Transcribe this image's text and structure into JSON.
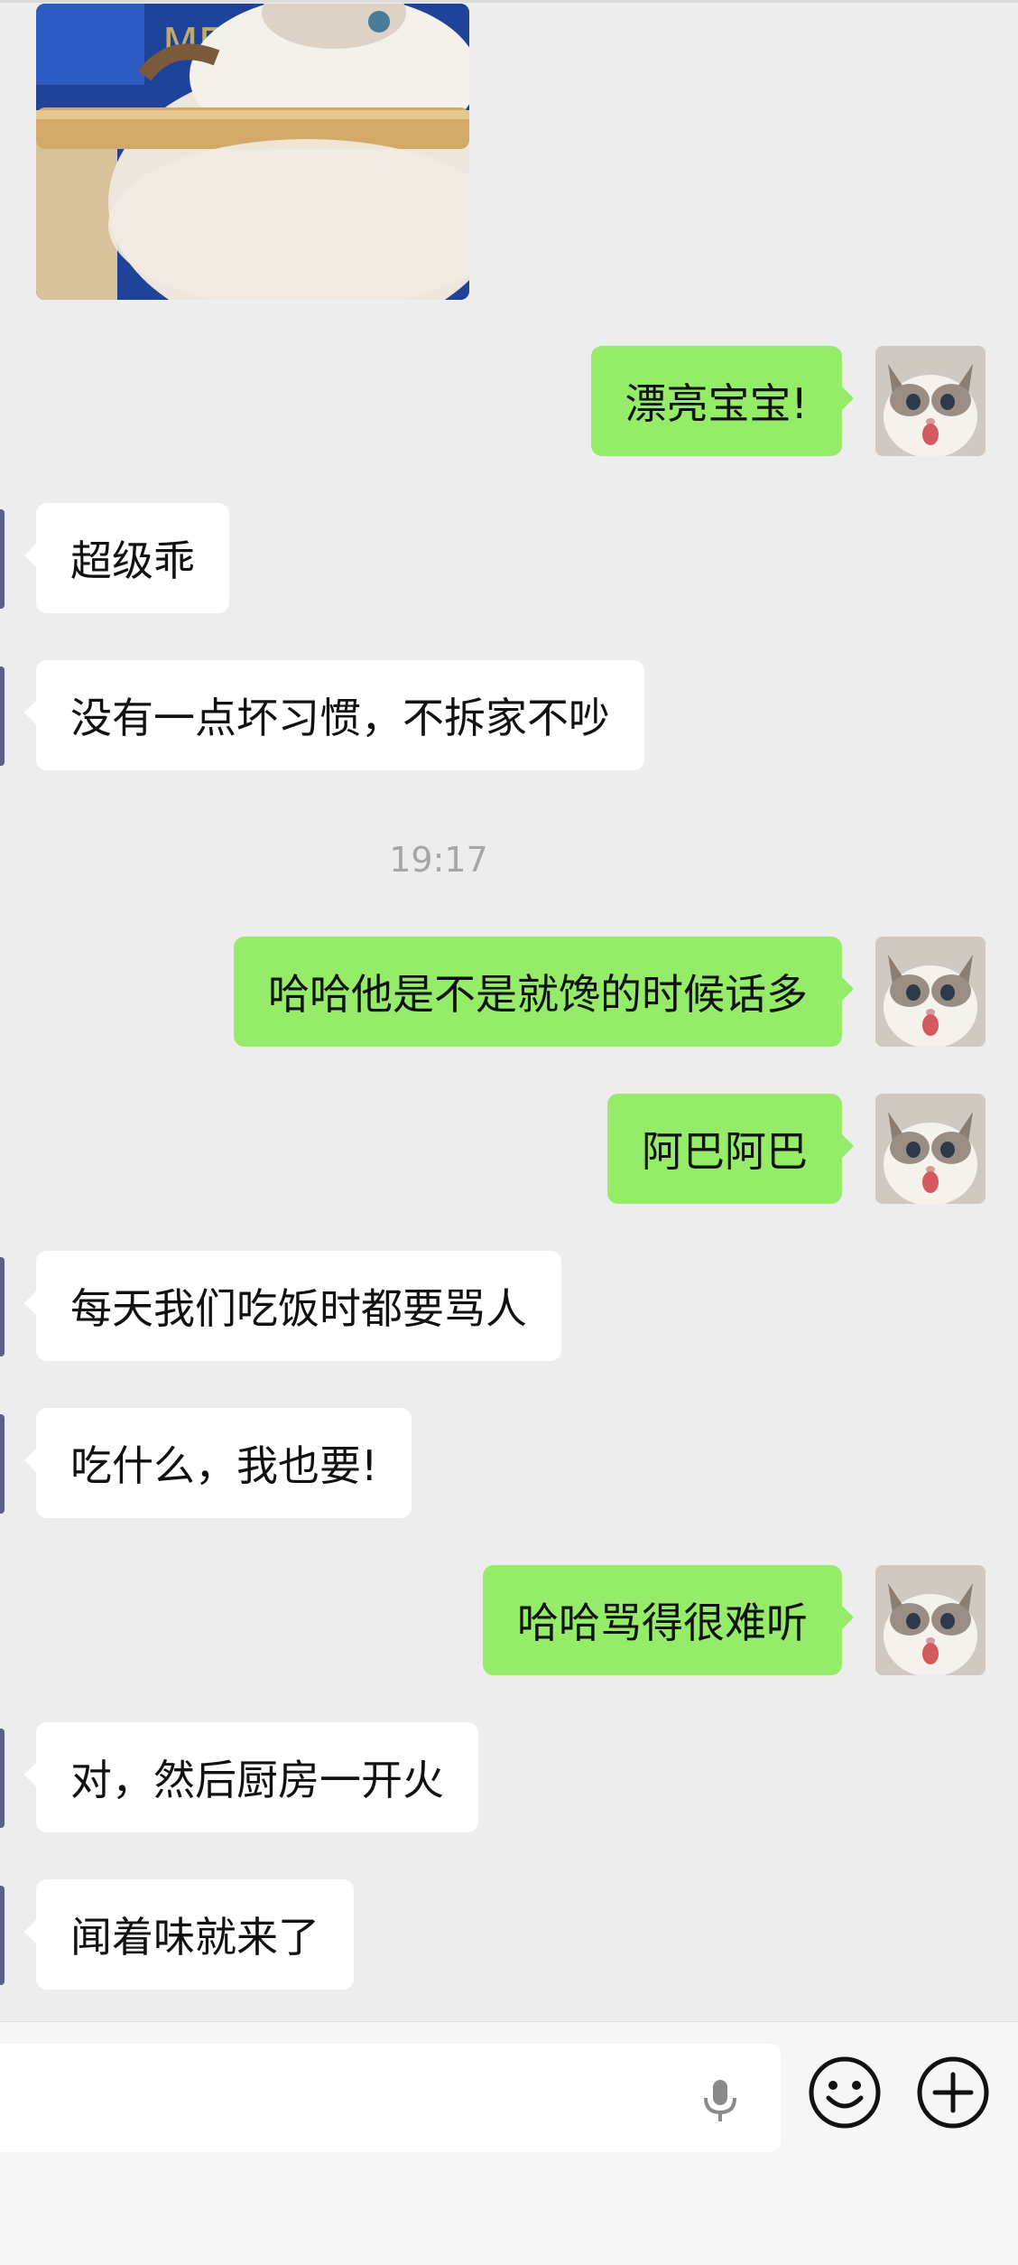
{
  "messages": [
    {
      "side": "in",
      "text": "超级乖"
    },
    {
      "side": "in",
      "text": "没有一点坏习惯，不拆家不吵"
    },
    {
      "side": "out",
      "text": "漂亮宝宝!"
    },
    {
      "side": "out",
      "text": "哈哈他是不是就馋的时候话多"
    },
    {
      "side": "out",
      "text": "阿巴阿巴"
    },
    {
      "side": "in",
      "text": "每天我们吃饭时都要骂人"
    },
    {
      "side": "in",
      "text": "吃什么，我也要!"
    },
    {
      "side": "out",
      "text": "哈哈骂得很难听"
    },
    {
      "side": "in",
      "text": "对，然后厨房一开火"
    },
    {
      "side": "in",
      "text": "闻着味就来了"
    }
  ],
  "timestamp": "19:17",
  "input": {
    "value": "",
    "placeholder": ""
  },
  "icons": {
    "mic": "microphone-icon",
    "emoji": "smiley-face-icon",
    "plus": "plus-circle-icon"
  },
  "colors": {
    "background": "#ededed",
    "outgoing_bubble": "#95ec69",
    "incoming_bubble": "#ffffff",
    "timestamp_text": "#a6a6a6"
  }
}
